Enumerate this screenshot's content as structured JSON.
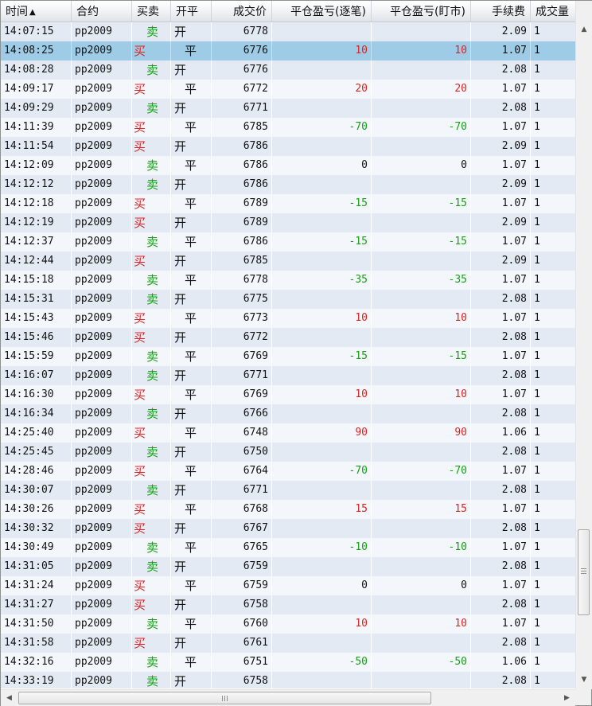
{
  "columns": {
    "time": "时间",
    "contract": "合约",
    "side": "买卖",
    "open_close": "开平",
    "price": "成交价",
    "pnl_trade": "平仓盈亏(逐笔)",
    "pnl_mark": "平仓盈亏(盯市)",
    "fee": "手续费",
    "volume": "成交量"
  },
  "sort": {
    "column": "time",
    "direction": "ascending",
    "icon": "sort-ascending-icon"
  },
  "colors": {
    "buy": "#e02020",
    "sell": "#13a013",
    "selected_row": "#9ecce6",
    "row_odd": "#e4eaf3",
    "row_even": "#f3f7fc"
  },
  "scrollbars": {
    "vertical": {
      "up_icon": "arrow-up-icon",
      "down_icon": "arrow-down-icon"
    },
    "horizontal": {
      "left_icon": "arrow-left-icon",
      "right_icon": "arrow-right-icon"
    }
  },
  "selected_index": 1,
  "trades": [
    {
      "time": "14:07:15",
      "contract": "pp2009",
      "side": "卖",
      "oc": "开",
      "price": "6778",
      "pnl_trade": "",
      "pnl_mark": "",
      "fee": "2.09",
      "volume": "1"
    },
    {
      "time": "14:08:25",
      "contract": "pp2009",
      "side": "买",
      "oc": "平",
      "price": "6776",
      "pnl_trade": "10",
      "pnl_mark": "10",
      "fee": "1.07",
      "volume": "1"
    },
    {
      "time": "14:08:28",
      "contract": "pp2009",
      "side": "卖",
      "oc": "开",
      "price": "6776",
      "pnl_trade": "",
      "pnl_mark": "",
      "fee": "2.08",
      "volume": "1"
    },
    {
      "time": "14:09:17",
      "contract": "pp2009",
      "side": "买",
      "oc": "平",
      "price": "6772",
      "pnl_trade": "20",
      "pnl_mark": "20",
      "fee": "1.07",
      "volume": "1"
    },
    {
      "time": "14:09:29",
      "contract": "pp2009",
      "side": "卖",
      "oc": "开",
      "price": "6771",
      "pnl_trade": "",
      "pnl_mark": "",
      "fee": "2.08",
      "volume": "1"
    },
    {
      "time": "14:11:39",
      "contract": "pp2009",
      "side": "买",
      "oc": "平",
      "price": "6785",
      "pnl_trade": "-70",
      "pnl_mark": "-70",
      "fee": "1.07",
      "volume": "1"
    },
    {
      "time": "14:11:54",
      "contract": "pp2009",
      "side": "买",
      "oc": "开",
      "price": "6786",
      "pnl_trade": "",
      "pnl_mark": "",
      "fee": "2.09",
      "volume": "1"
    },
    {
      "time": "14:12:09",
      "contract": "pp2009",
      "side": "卖",
      "oc": "平",
      "price": "6786",
      "pnl_trade": "0",
      "pnl_mark": "0",
      "fee": "1.07",
      "volume": "1"
    },
    {
      "time": "14:12:12",
      "contract": "pp2009",
      "side": "卖",
      "oc": "开",
      "price": "6786",
      "pnl_trade": "",
      "pnl_mark": "",
      "fee": "2.09",
      "volume": "1"
    },
    {
      "time": "14:12:18",
      "contract": "pp2009",
      "side": "买",
      "oc": "平",
      "price": "6789",
      "pnl_trade": "-15",
      "pnl_mark": "-15",
      "fee": "1.07",
      "volume": "1"
    },
    {
      "time": "14:12:19",
      "contract": "pp2009",
      "side": "买",
      "oc": "开",
      "price": "6789",
      "pnl_trade": "",
      "pnl_mark": "",
      "fee": "2.09",
      "volume": "1"
    },
    {
      "time": "14:12:37",
      "contract": "pp2009",
      "side": "卖",
      "oc": "平",
      "price": "6786",
      "pnl_trade": "-15",
      "pnl_mark": "-15",
      "fee": "1.07",
      "volume": "1"
    },
    {
      "time": "14:12:44",
      "contract": "pp2009",
      "side": "买",
      "oc": "开",
      "price": "6785",
      "pnl_trade": "",
      "pnl_mark": "",
      "fee": "2.09",
      "volume": "1"
    },
    {
      "time": "14:15:18",
      "contract": "pp2009",
      "side": "卖",
      "oc": "平",
      "price": "6778",
      "pnl_trade": "-35",
      "pnl_mark": "-35",
      "fee": "1.07",
      "volume": "1"
    },
    {
      "time": "14:15:31",
      "contract": "pp2009",
      "side": "卖",
      "oc": "开",
      "price": "6775",
      "pnl_trade": "",
      "pnl_mark": "",
      "fee": "2.08",
      "volume": "1"
    },
    {
      "time": "14:15:43",
      "contract": "pp2009",
      "side": "买",
      "oc": "平",
      "price": "6773",
      "pnl_trade": "10",
      "pnl_mark": "10",
      "fee": "1.07",
      "volume": "1"
    },
    {
      "time": "14:15:46",
      "contract": "pp2009",
      "side": "买",
      "oc": "开",
      "price": "6772",
      "pnl_trade": "",
      "pnl_mark": "",
      "fee": "2.08",
      "volume": "1"
    },
    {
      "time": "14:15:59",
      "contract": "pp2009",
      "side": "卖",
      "oc": "平",
      "price": "6769",
      "pnl_trade": "-15",
      "pnl_mark": "-15",
      "fee": "1.07",
      "volume": "1"
    },
    {
      "time": "14:16:07",
      "contract": "pp2009",
      "side": "卖",
      "oc": "开",
      "price": "6771",
      "pnl_trade": "",
      "pnl_mark": "",
      "fee": "2.08",
      "volume": "1"
    },
    {
      "time": "14:16:30",
      "contract": "pp2009",
      "side": "买",
      "oc": "平",
      "price": "6769",
      "pnl_trade": "10",
      "pnl_mark": "10",
      "fee": "1.07",
      "volume": "1"
    },
    {
      "time": "14:16:34",
      "contract": "pp2009",
      "side": "卖",
      "oc": "开",
      "price": "6766",
      "pnl_trade": "",
      "pnl_mark": "",
      "fee": "2.08",
      "volume": "1"
    },
    {
      "time": "14:25:40",
      "contract": "pp2009",
      "side": "买",
      "oc": "平",
      "price": "6748",
      "pnl_trade": "90",
      "pnl_mark": "90",
      "fee": "1.06",
      "volume": "1"
    },
    {
      "time": "14:25:45",
      "contract": "pp2009",
      "side": "卖",
      "oc": "开",
      "price": "6750",
      "pnl_trade": "",
      "pnl_mark": "",
      "fee": "2.08",
      "volume": "1"
    },
    {
      "time": "14:28:46",
      "contract": "pp2009",
      "side": "买",
      "oc": "平",
      "price": "6764",
      "pnl_trade": "-70",
      "pnl_mark": "-70",
      "fee": "1.07",
      "volume": "1"
    },
    {
      "time": "14:30:07",
      "contract": "pp2009",
      "side": "卖",
      "oc": "开",
      "price": "6771",
      "pnl_trade": "",
      "pnl_mark": "",
      "fee": "2.08",
      "volume": "1"
    },
    {
      "time": "14:30:26",
      "contract": "pp2009",
      "side": "买",
      "oc": "平",
      "price": "6768",
      "pnl_trade": "15",
      "pnl_mark": "15",
      "fee": "1.07",
      "volume": "1"
    },
    {
      "time": "14:30:32",
      "contract": "pp2009",
      "side": "买",
      "oc": "开",
      "price": "6767",
      "pnl_trade": "",
      "pnl_mark": "",
      "fee": "2.08",
      "volume": "1"
    },
    {
      "time": "14:30:49",
      "contract": "pp2009",
      "side": "卖",
      "oc": "平",
      "price": "6765",
      "pnl_trade": "-10",
      "pnl_mark": "-10",
      "fee": "1.07",
      "volume": "1"
    },
    {
      "time": "14:31:05",
      "contract": "pp2009",
      "side": "卖",
      "oc": "开",
      "price": "6759",
      "pnl_trade": "",
      "pnl_mark": "",
      "fee": "2.08",
      "volume": "1"
    },
    {
      "time": "14:31:24",
      "contract": "pp2009",
      "side": "买",
      "oc": "平",
      "price": "6759",
      "pnl_trade": "0",
      "pnl_mark": "0",
      "fee": "1.07",
      "volume": "1"
    },
    {
      "time": "14:31:27",
      "contract": "pp2009",
      "side": "买",
      "oc": "开",
      "price": "6758",
      "pnl_trade": "",
      "pnl_mark": "",
      "fee": "2.08",
      "volume": "1"
    },
    {
      "time": "14:31:50",
      "contract": "pp2009",
      "side": "卖",
      "oc": "平",
      "price": "6760",
      "pnl_trade": "10",
      "pnl_mark": "10",
      "fee": "1.07",
      "volume": "1"
    },
    {
      "time": "14:31:58",
      "contract": "pp2009",
      "side": "买",
      "oc": "开",
      "price": "6761",
      "pnl_trade": "",
      "pnl_mark": "",
      "fee": "2.08",
      "volume": "1"
    },
    {
      "time": "14:32:16",
      "contract": "pp2009",
      "side": "卖",
      "oc": "平",
      "price": "6751",
      "pnl_trade": "-50",
      "pnl_mark": "-50",
      "fee": "1.06",
      "volume": "1"
    },
    {
      "time": "14:33:19",
      "contract": "pp2009",
      "side": "卖",
      "oc": "开",
      "price": "6758",
      "pnl_trade": "",
      "pnl_mark": "",
      "fee": "2.08",
      "volume": "1"
    }
  ]
}
